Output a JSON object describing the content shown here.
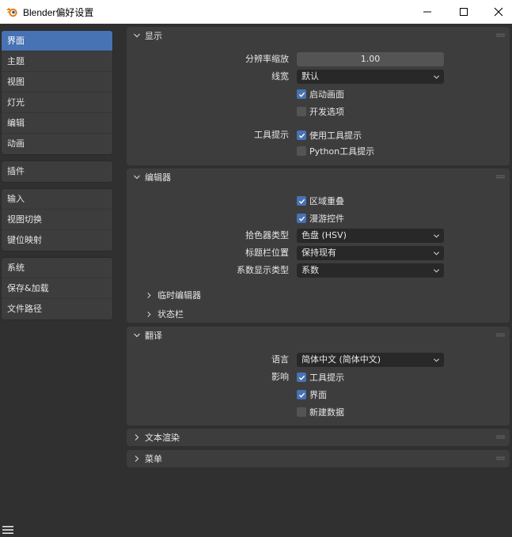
{
  "window": {
    "title": "Blender偏好设置"
  },
  "sidebar": {
    "groups": [
      [
        {
          "label": "界面",
          "active": true
        },
        {
          "label": "主题"
        },
        {
          "label": "视图"
        },
        {
          "label": "灯光"
        },
        {
          "label": "编辑"
        },
        {
          "label": "动画"
        }
      ],
      [
        {
          "label": "插件"
        }
      ],
      [
        {
          "label": "输入"
        },
        {
          "label": "视图切换"
        },
        {
          "label": "键位映射"
        }
      ],
      [
        {
          "label": "系统"
        },
        {
          "label": "保存&加载"
        },
        {
          "label": "文件路径"
        }
      ]
    ]
  },
  "display": {
    "title": "显示",
    "resolution_scale_label": "分辨率缩放",
    "resolution_scale_value": "1.00",
    "line_width_label": "线宽",
    "line_width_value": "默认",
    "splash_screen": "启动画面",
    "developer_extras": "开发选项",
    "tooltips_label": "工具提示",
    "user_tooltips": "使用工具提示",
    "python_tooltips": "Python工具提示"
  },
  "editors": {
    "title": "编辑器",
    "region_overlap": "区域重叠",
    "navigation_controls": "漫游控件",
    "color_picker_label": "拾色器类型",
    "color_picker_value": "色盘 (HSV)",
    "header_position_label": "标题栏位置",
    "header_position_value": "保持现有",
    "factor_display_label": "系数显示类型",
    "factor_display_value": "系数",
    "temp_editors": "临时编辑器",
    "status_bar": "状态栏"
  },
  "translation": {
    "title": "翻译",
    "language_label": "语言",
    "language_value": "简体中文 (简体中文)",
    "affect_label": "影响",
    "affect_tooltips": "工具提示",
    "affect_interface": "界面",
    "affect_new_data": "新建数据"
  },
  "text_rendering": {
    "title": "文本渲染"
  },
  "menus": {
    "title": "菜单"
  },
  "colors": {
    "accent": "#4772b3",
    "background": "#303030",
    "panel": "#3d3d3d"
  }
}
